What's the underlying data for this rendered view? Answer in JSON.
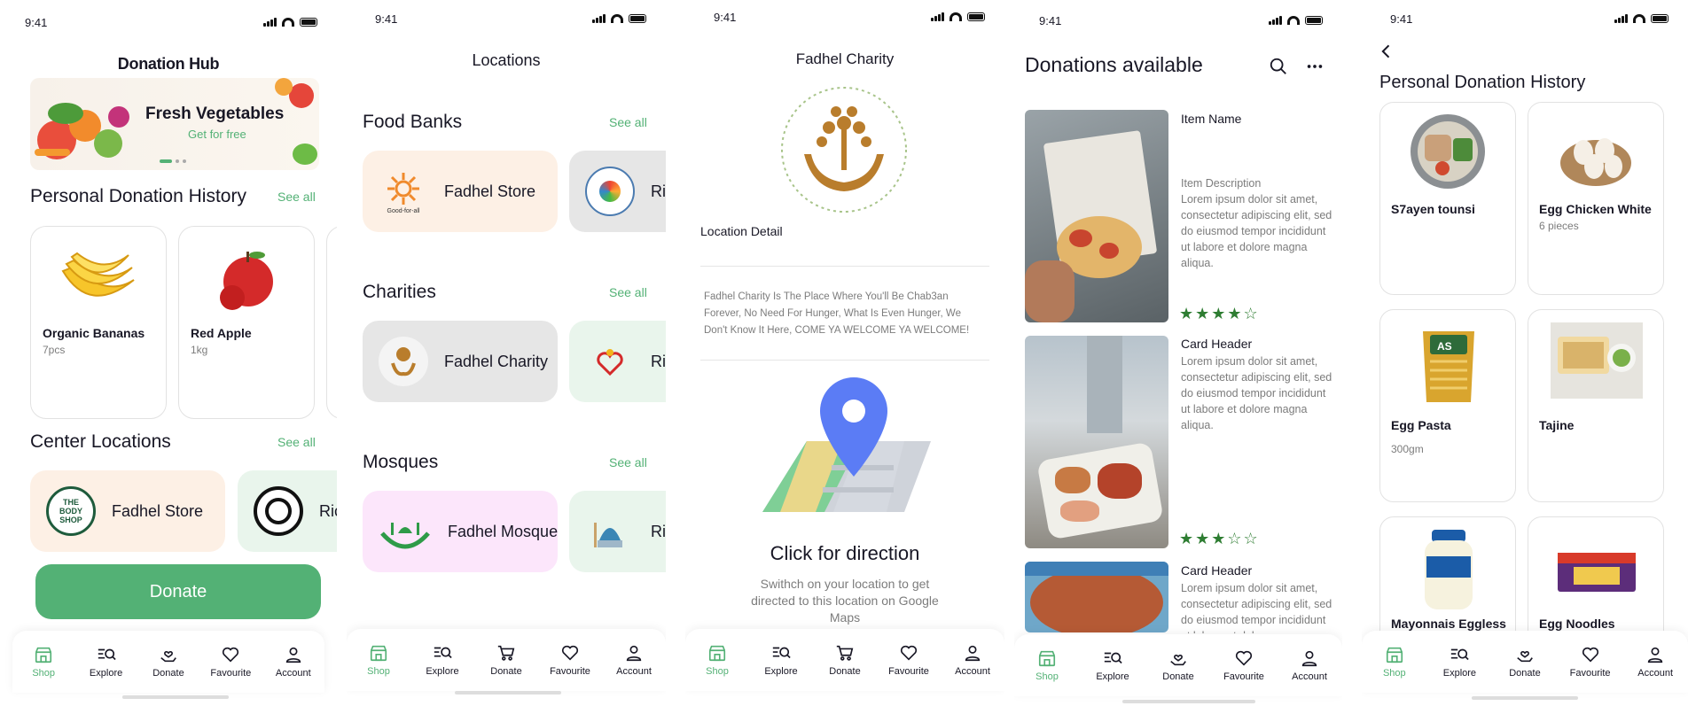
{
  "status_time": "9:41",
  "nav_labels": [
    "Shop",
    "Explore",
    "Donate",
    "Favourite",
    "Account"
  ],
  "screen1": {
    "title": "Donation Hub",
    "banner": {
      "title": "Fresh Vegetables",
      "subtitle": "Get for free"
    },
    "history": {
      "title": "Personal Donation History",
      "see_all": "See all",
      "items": [
        {
          "name": "Organic Bananas",
          "qty": "7pcs"
        },
        {
          "name": "Red Apple",
          "qty": "1kg"
        }
      ]
    },
    "centers": {
      "title": "Center Locations",
      "see_all": "See all",
      "items": [
        "Fadhel Store",
        "Ric"
      ]
    },
    "donate_button": "Donate"
  },
  "screen2": {
    "title": "Locations",
    "sections": [
      {
        "title": "Food Banks",
        "see_all": "See all",
        "items": [
          "Fadhel Store",
          "Ri"
        ],
        "logo_text": "Good-for-all"
      },
      {
        "title": "Charities",
        "see_all": "See all",
        "items": [
          "Fadhel Charity",
          "Ri"
        ]
      },
      {
        "title": "Mosques",
        "see_all": "See all",
        "items": [
          "Fadhel Mosque",
          "Ri"
        ]
      }
    ]
  },
  "screen3": {
    "title": "Fadhel Charity",
    "location_detail": "Location Detail",
    "description": "Fadhel Charity Is The Place Where You'll Be Chab3an Forever, No Need For Hunger, What Is Even Hunger, We Don't Know It Here, COME YA WELCOME YA WELCOME!",
    "cta_title": "Click for direction",
    "cta_sub": "Swithch on your location to get directed to this location on Google Maps"
  },
  "screen4": {
    "title": "Donations available",
    "items": [
      {
        "header": "Item Name",
        "desc_label": "Item Description",
        "desc": "Lorem ipsum dolor sit amet, consectetur adipiscing elit, sed do eiusmod tempor incididunt ut labore et dolore magna aliqua.",
        "rating": 4
      },
      {
        "header": "Card Header",
        "desc": "Lorem ipsum dolor sit amet, consectetur adipiscing elit, sed do eiusmod tempor incididunt ut labore et dolore magna aliqua.",
        "rating": 3
      },
      {
        "header": "Card Header",
        "desc": "Lorem ipsum dolor sit amet, consectetur adipiscing elit, sed do eiusmod tempor incididunt ut labore et dolore magna aliqua."
      }
    ]
  },
  "screen5": {
    "title": "Personal Donation History",
    "items": [
      {
        "name": "S7ayen tounsi",
        "qty": ""
      },
      {
        "name": "Egg Chicken White",
        "qty": "6 pieces"
      },
      {
        "name": "Egg Pasta",
        "qty": "300gm"
      },
      {
        "name": "Tajine",
        "qty": ""
      },
      {
        "name": "Mayonnais Eggless",
        "qty": ""
      },
      {
        "name": "Egg Noodles",
        "qty": ""
      }
    ]
  },
  "colors": {
    "accent": "#53B175",
    "peach": "#FDF0E5",
    "grey": "#E6E6E6",
    "mint": "#E9F5EC",
    "pink": "#FCE6FB",
    "star": "#2E7D32"
  }
}
